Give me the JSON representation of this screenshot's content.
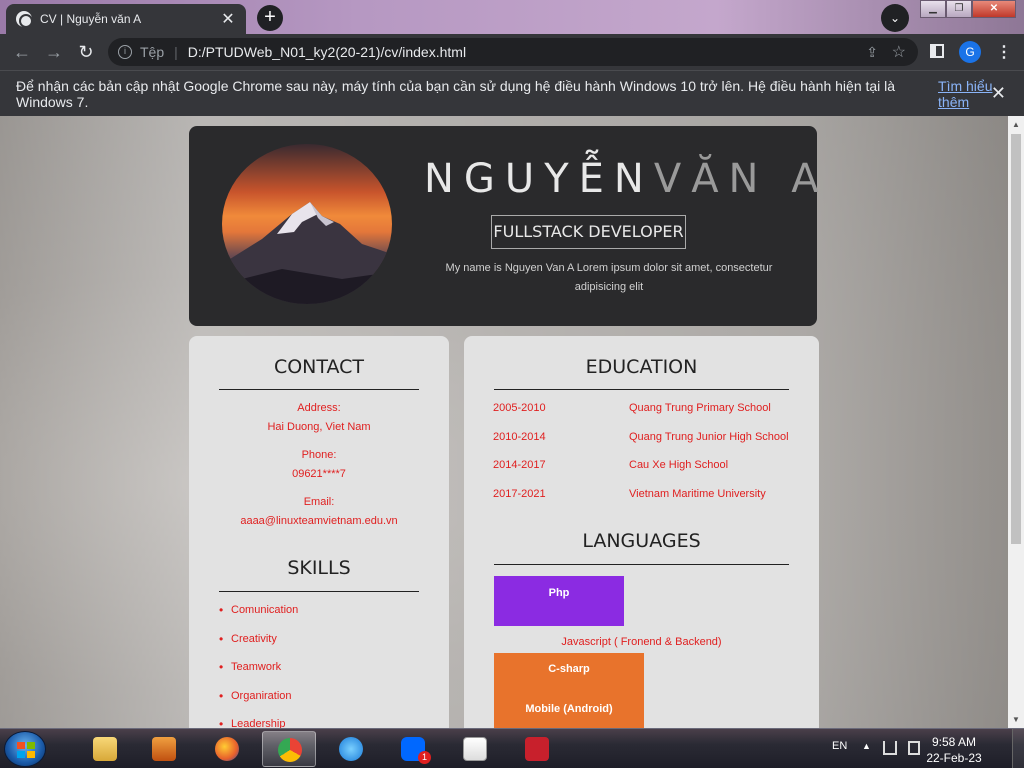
{
  "browser": {
    "tab_title": "CV | Nguyễn văn A",
    "tab_close": "✕",
    "new_tab": "+",
    "tab_search": "⌄",
    "window_controls": {
      "minimize": "▁",
      "maximize": "❐",
      "close": "✕"
    },
    "address": {
      "scheme": "Tệp",
      "separator": "|",
      "url": "D:/PTUDWeb_N01_ky2(20-21)/cv/index.html"
    },
    "profile_initial": "G",
    "infobar": {
      "message": "Để nhận các bản cập nhật Google Chrome sau này, máy tính của bạn cần sử dụng hệ điều hành Windows 10 trở lên. Hệ điều hành hiện tại là Windows 7.",
      "link": "Tìm hiểu thêm",
      "close": "✕"
    }
  },
  "cv": {
    "name_first": "NGUYỄN",
    "name_last": "VĂN A",
    "role": "FULLSTACK DEVELOPER",
    "intro_line1": "My name is Nguyen Van A Lorem ipsum dolor sit amet, consectetur",
    "intro_line2": "adipisicing elit",
    "contact": {
      "heading": "CONTACT",
      "address_label": "Address:",
      "address_value": "Hai Duong, Viet Nam",
      "phone_label": "Phone:",
      "phone_value": "09621****7",
      "email_label": "Email:",
      "email_value": "aaaa@linuxteamvietnam.edu.vn"
    },
    "skills": {
      "heading": "SKILLS",
      "items": [
        "Comunication",
        "Creativity",
        "Teamwork",
        "Organiration",
        "Leadership"
      ]
    },
    "education": {
      "heading": "EDUCATION",
      "rows": [
        {
          "years": "2005-2010",
          "school": "Quang Trung Primary School"
        },
        {
          "years": "2010-2014",
          "school": "Quang Trung Junior High School"
        },
        {
          "years": "2014-2017",
          "school": "Cau Xe High School"
        },
        {
          "years": "2017-2021",
          "school": "Vietnam Maritime University"
        }
      ]
    },
    "languages": {
      "heading": "LANGUAGES",
      "items": [
        {
          "label": "Php",
          "color": "#8b2be2"
        },
        {
          "label": "Javascript ( Fronend & Backend)",
          "color": "#e2e2e2"
        },
        {
          "label": "C-sharp",
          "color": "#e8732c"
        },
        {
          "label": "Mobile (Android)",
          "color": "#e8732c"
        }
      ]
    }
  },
  "taskbar": {
    "lang": "EN",
    "time": "9:58 AM",
    "date": "22-Feb-23",
    "zalo_badge": "1"
  }
}
